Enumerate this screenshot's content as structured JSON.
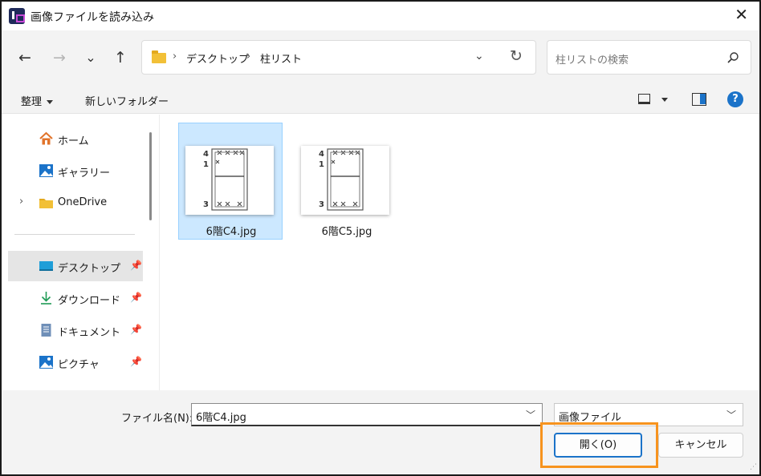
{
  "window": {
    "title": "画像ファイルを読み込み",
    "close_glyph": "✕"
  },
  "nav": {
    "back": "←",
    "forward": "→",
    "recent": "⌄",
    "up": "↑"
  },
  "address": {
    "sep": "›",
    "crumbs": [
      "デスクトップ",
      "柱リスト"
    ],
    "chevron": "⌄",
    "refresh": "↻"
  },
  "search": {
    "placeholder": "柱リストの検索"
  },
  "commands": {
    "organize": "整理",
    "new_folder": "新しいフォルダー",
    "help": "?"
  },
  "sidebar": {
    "items": [
      {
        "label": "ホーム",
        "icon": "home-icon"
      },
      {
        "label": "ギャラリー",
        "icon": "gallery-icon"
      },
      {
        "label": "OneDrive",
        "icon": "folder-icon",
        "expander": "›"
      },
      {
        "label": "デスクトップ",
        "icon": "desktop-icon",
        "pinned": true,
        "selected": true
      },
      {
        "label": "ダウンロード",
        "icon": "download-icon",
        "pinned": true
      },
      {
        "label": "ドキュメント",
        "icon": "document-icon",
        "pinned": true
      },
      {
        "label": "ピクチャ",
        "icon": "picture-icon",
        "pinned": true
      }
    ]
  },
  "files": [
    {
      "name": "6階C4.jpg",
      "selected": true
    },
    {
      "name": "6階C5.jpg",
      "selected": false
    }
  ],
  "thumbnail": {
    "label_top1": "4",
    "label_top2": "1",
    "label_bottom": "3"
  },
  "footer": {
    "filename_label": "ファイル名(N):",
    "filename_value": "6階C4.jpg",
    "filetype_value": "画像ファイル",
    "open_label": "開く(O)",
    "cancel_label": "キャンセル"
  },
  "colors": {
    "accent": "#1b73c9",
    "selection": "#cce8ff",
    "highlight": "#f7931e"
  }
}
